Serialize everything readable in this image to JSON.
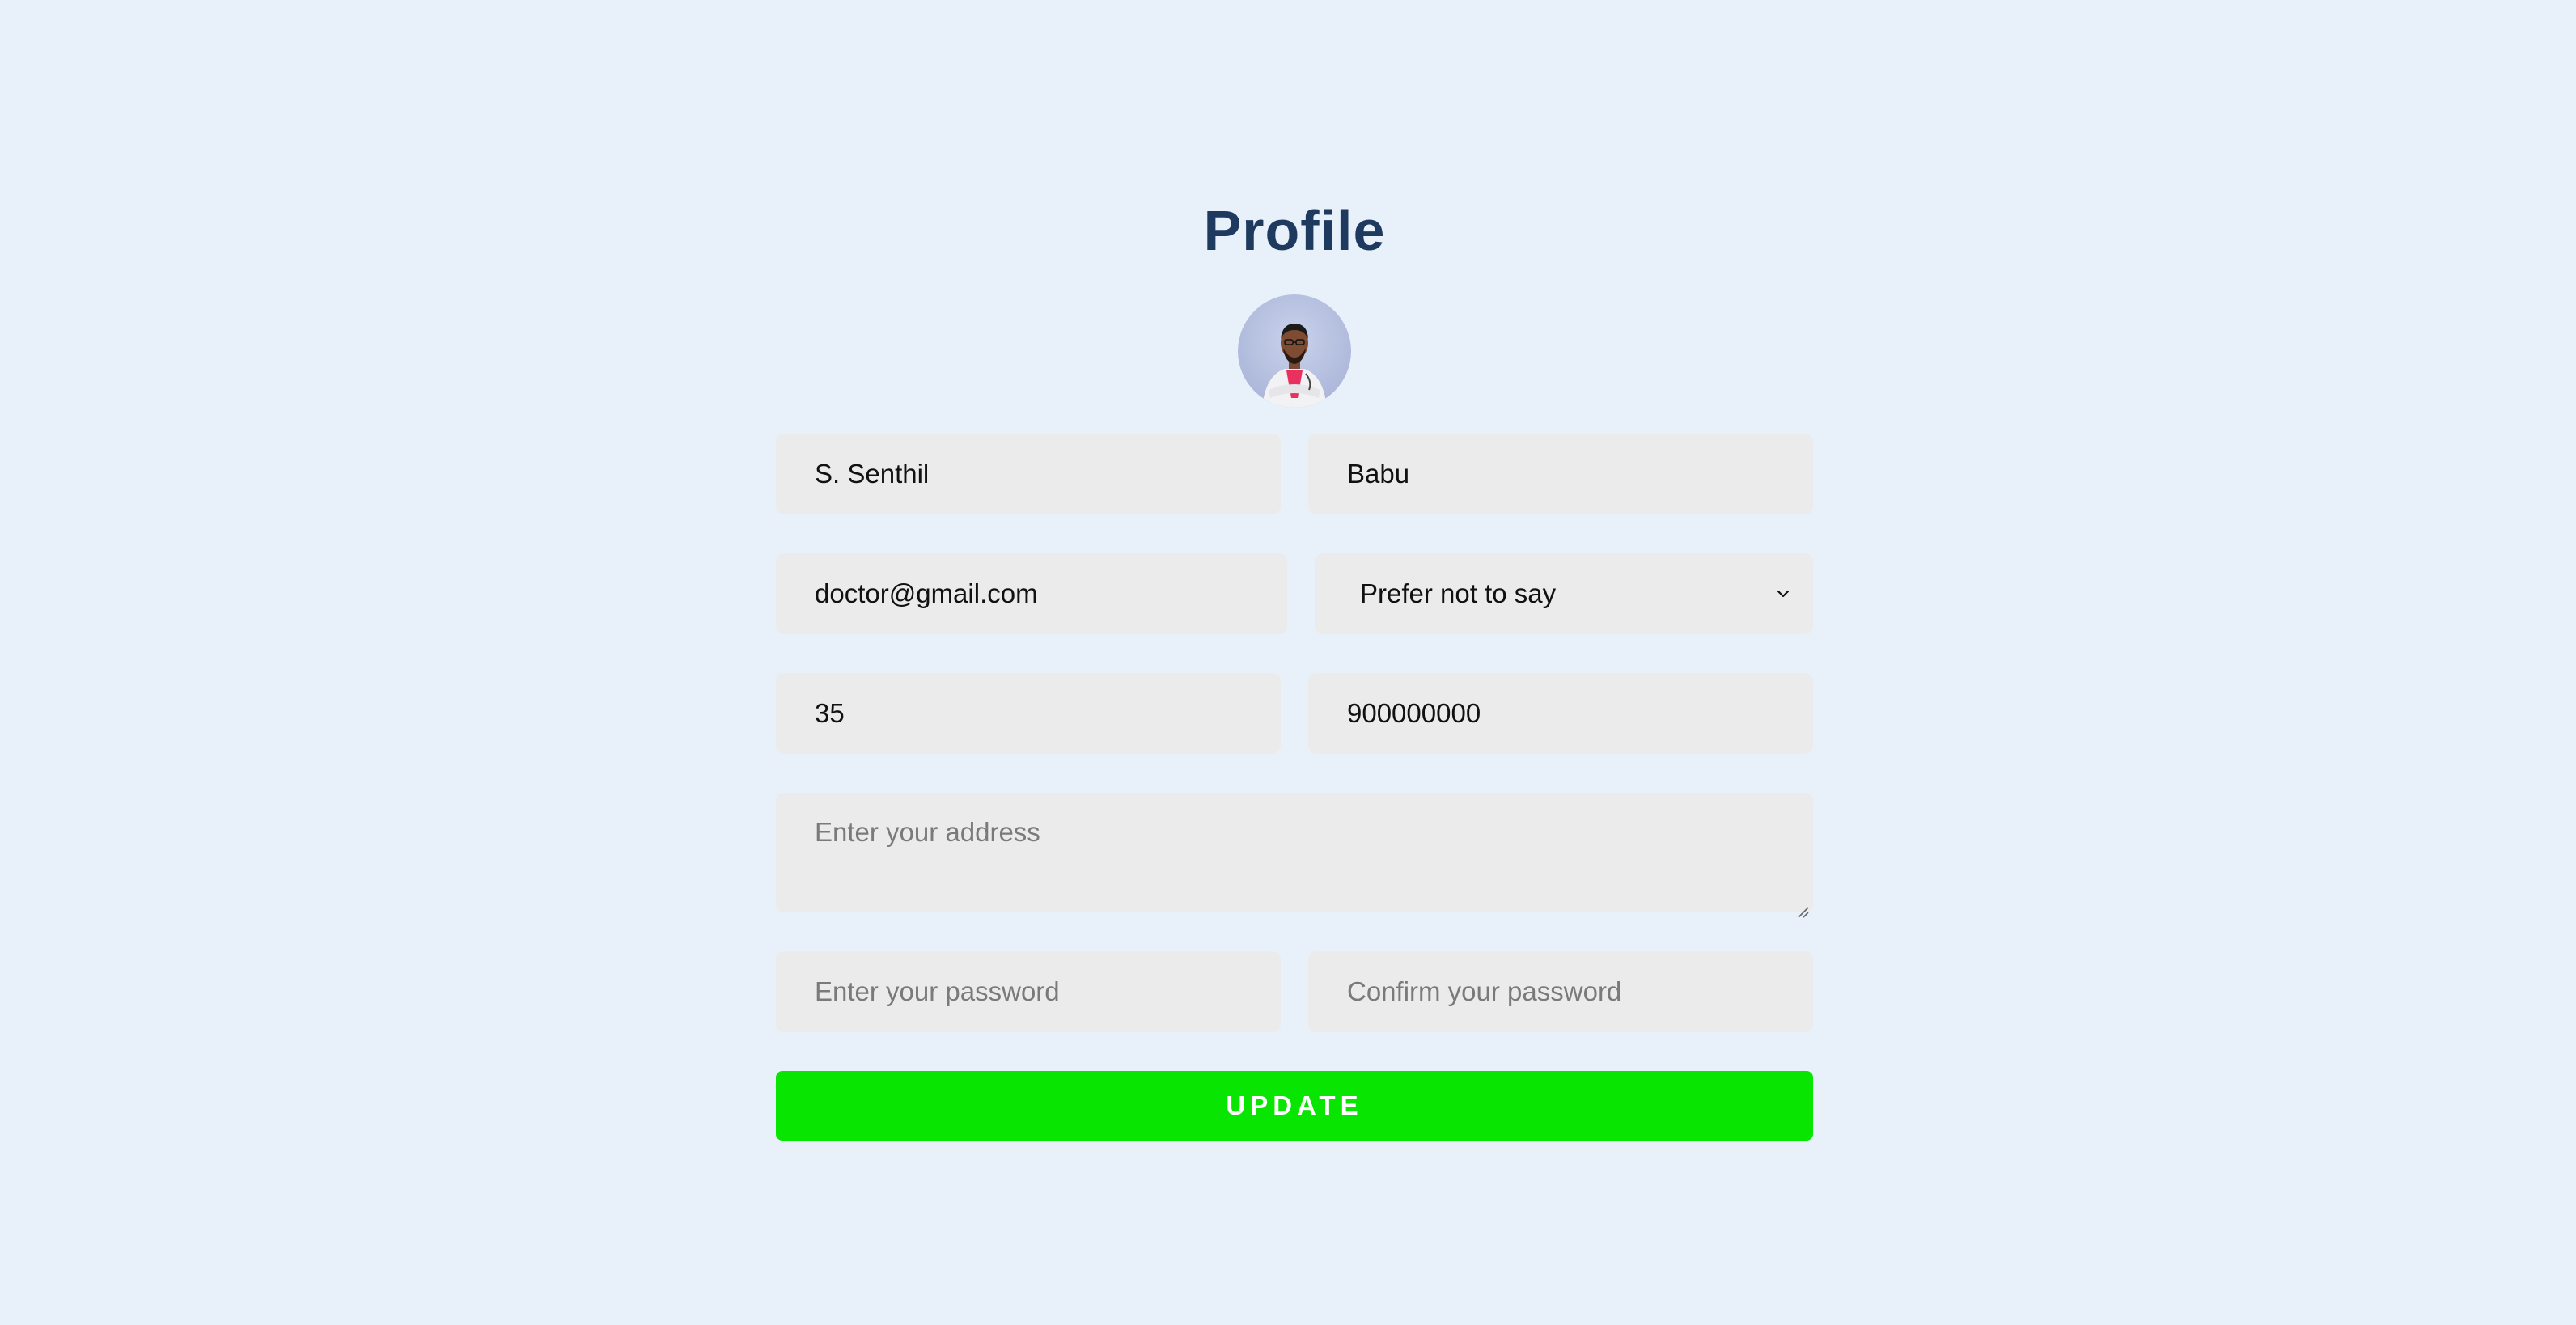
{
  "page": {
    "title": "Profile"
  },
  "avatar": {
    "icon": "doctor-photo",
    "bg_color": "#b7c1e0"
  },
  "form": {
    "first_name": "S. Senthil",
    "last_name": "Babu",
    "email": "doctor@gmail.com",
    "gender": "Prefer not to say",
    "age": "35",
    "phone": "900000000",
    "address_placeholder": "Enter your address",
    "password_placeholder": "Enter your password",
    "confirm_password_placeholder": "Confirm your password",
    "update_label": "UPDATE"
  },
  "colors": {
    "background": "#e8f1fa",
    "title": "#1f3a5f",
    "field_bg": "#ebebeb",
    "button": "#07e500"
  }
}
